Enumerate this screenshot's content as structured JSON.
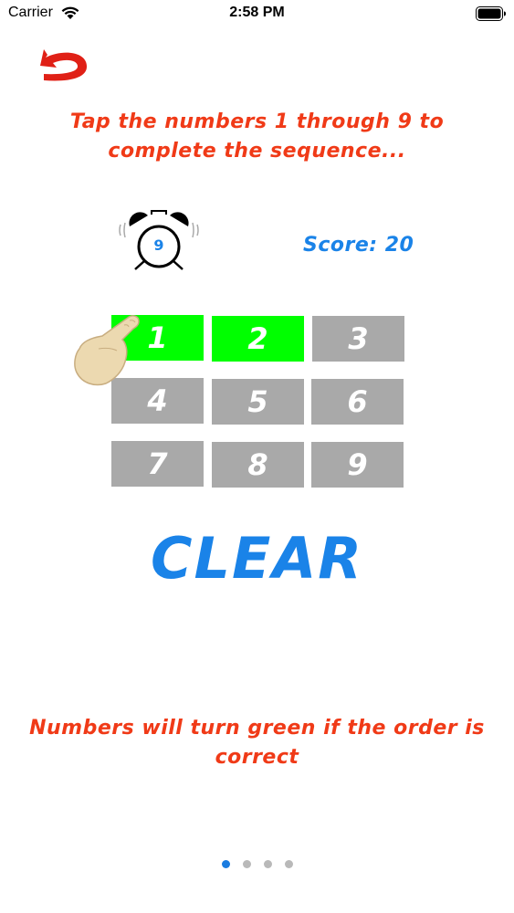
{
  "status_bar": {
    "carrier": "Carrier",
    "time": "2:58 PM"
  },
  "back": {
    "icon": "back-arrow-icon",
    "color": "#e02016"
  },
  "instructions": {
    "top": "Tap the numbers 1 through 9 to complete the sequence...",
    "bottom": "Numbers will turn green if the order is correct"
  },
  "timer": {
    "icon": "alarm-clock-icon",
    "value": "9"
  },
  "score": {
    "label": "Score: 20"
  },
  "grid": {
    "cells": [
      {
        "label": "1",
        "state": "correct"
      },
      {
        "label": "2",
        "state": "correct"
      },
      {
        "label": "3",
        "state": "default"
      },
      {
        "label": "4",
        "state": "default"
      },
      {
        "label": "5",
        "state": "default"
      },
      {
        "label": "6",
        "state": "default"
      },
      {
        "label": "7",
        "state": "default"
      },
      {
        "label": "8",
        "state": "default"
      },
      {
        "label": "9",
        "state": "default"
      }
    ]
  },
  "clear_button": {
    "label": "CLEAR"
  },
  "page_indicator": {
    "total": 4,
    "current": 1
  },
  "colors": {
    "instruction_red": "#f03a17",
    "accent_blue": "#1a83e8",
    "correct_green": "#00ff00",
    "default_gray": "#a9a9a9"
  }
}
